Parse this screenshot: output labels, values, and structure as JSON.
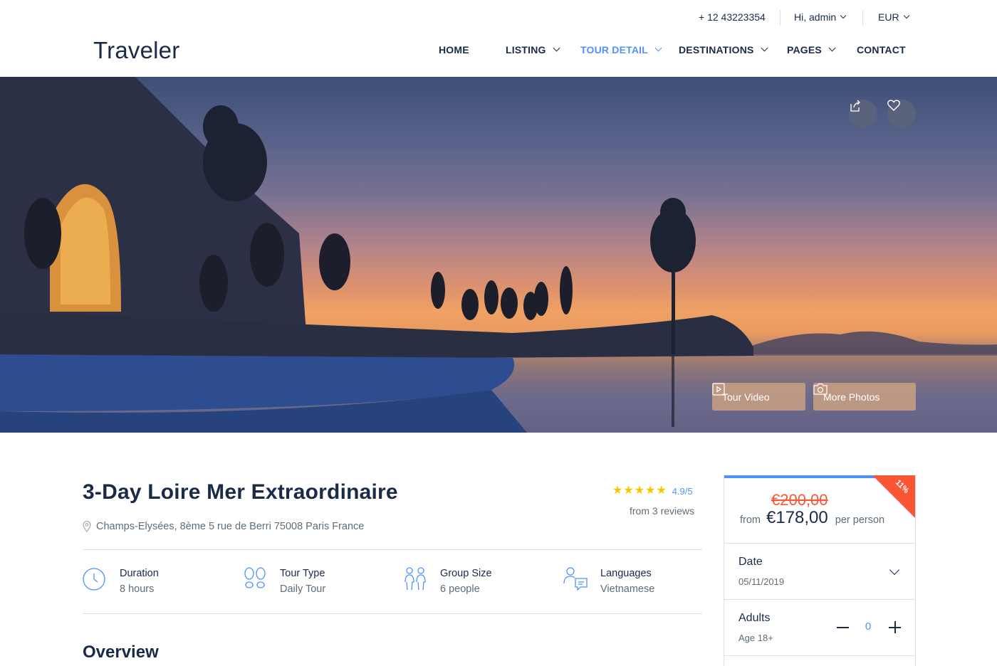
{
  "topbar": {
    "phone": "+ 12 43223354",
    "user": "Hi, admin",
    "currency": "EUR"
  },
  "logo": "Traveler",
  "nav": {
    "items": [
      {
        "label": "HOME"
      },
      {
        "label": "LISTING"
      },
      {
        "label": "TOUR DETAIL"
      },
      {
        "label": "DESTINATIONS"
      },
      {
        "label": "PAGES"
      },
      {
        "label": "CONTACT"
      }
    ]
  },
  "hero": {
    "buttons": {
      "video": "Tour Video",
      "photos": "More Photos"
    },
    "icons": [
      "share-icon",
      "heart-icon",
      "video-icon",
      "camera-icon"
    ]
  },
  "tour": {
    "title": "3-Day Loire Mer Extraordinaire",
    "address": "Champs-Elysées, 8ème 5 rue de Berri 75008 Paris France",
    "rating": "4.9/5",
    "reviews": "from 3 reviews",
    "stars": 5
  },
  "facts": [
    {
      "label": "Duration",
      "value": "8 hours",
      "icon": "clock-icon"
    },
    {
      "label": "Tour Type",
      "value": "Daily Tour",
      "icon": "footprints-icon"
    },
    {
      "label": "Group Size",
      "value": "6 people",
      "icon": "group-icon"
    },
    {
      "label": "Languages",
      "value": "Vietnamese",
      "icon": "language-icon"
    }
  ],
  "overview": {
    "heading": "Overview"
  },
  "booking": {
    "sale_badge": "11%",
    "old_price": "€200,00",
    "from_label": "from",
    "price": "€178,00",
    "unit": "per person",
    "date_label": "Date",
    "date_value": "05/11/2019",
    "adults_label": "Adults",
    "adults_sub": "Age 18+",
    "adults_count": "0"
  },
  "colors": {
    "primary": "#5191fa",
    "navy": "#1a2b48",
    "sale": "#fa5636",
    "star": "#fa5636"
  }
}
